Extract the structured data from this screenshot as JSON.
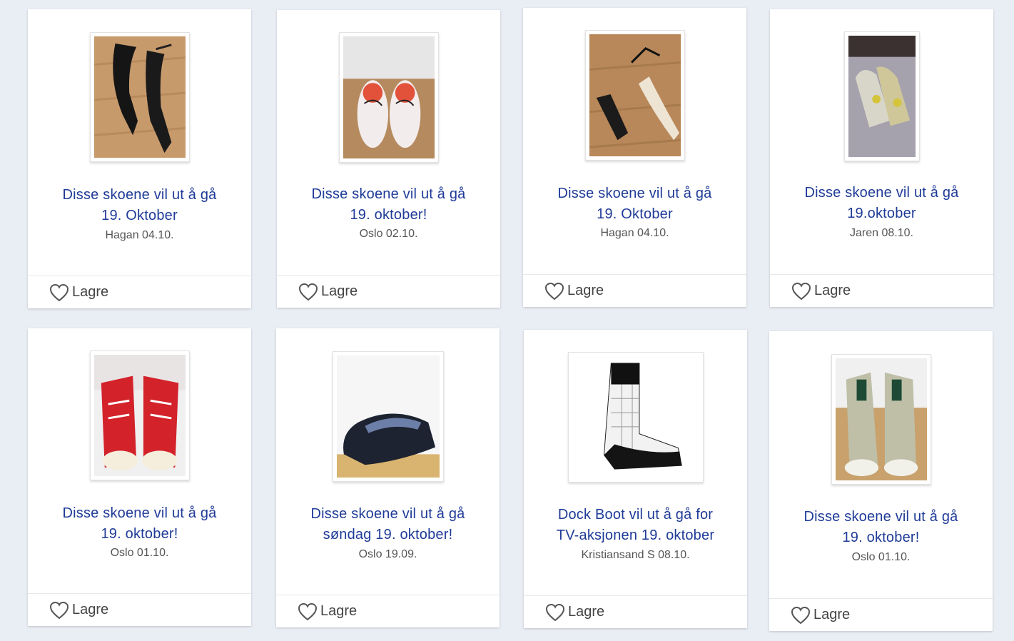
{
  "listings": [
    {
      "title_line1": "Disse skoene vil ut å gå",
      "title_line2": "19. Oktober",
      "location_date": "Hagan 04.10.",
      "save_label": "Lagre",
      "image": "black-strappy-heels-photo"
    },
    {
      "title_line1": "Disse skoene vil ut å gå",
      "title_line2": "19. oktober!",
      "location_date": "Oslo 02.10.",
      "save_label": "Lagre",
      "image": "white-loafers-photo"
    },
    {
      "title_line1": "Disse skoene vil ut å gå",
      "title_line2": "19. Oktober",
      "location_date": "Hagan 04.10.",
      "save_label": "Lagre",
      "image": "beige-heels-photo"
    },
    {
      "title_line1": "Disse skoene vil ut å gå",
      "title_line2": "19.oktober",
      "location_date": "Jaren 08.10.",
      "save_label": "Lagre",
      "image": "high-top-sneakers-photo"
    },
    {
      "title_line1": "Disse skoene vil ut å gå",
      "title_line2": "19. oktober!",
      "location_date": "Oslo 01.10.",
      "save_label": "Lagre",
      "image": "red-sneakers-photo"
    },
    {
      "title_line1": "Disse skoene vil ut å gå",
      "title_line2": "søndag 19. oktober!",
      "location_date": "Oslo 19.09.",
      "save_label": "Lagre",
      "image": "black-slip-on-photo"
    },
    {
      "title_line1": "Dock Boot vil ut å gå for",
      "title_line2": "TV-aksjonen 19. oktober",
      "location_date": "Kristiansand S 08.10.",
      "save_label": "Lagre",
      "image": "rubber-boot-photo"
    },
    {
      "title_line1": "Disse skoene vil ut å gå",
      "title_line2": "19. oktober!",
      "location_date": "Oslo 01.10.",
      "save_label": "Lagre",
      "image": "silver-sneakers-photo"
    }
  ]
}
